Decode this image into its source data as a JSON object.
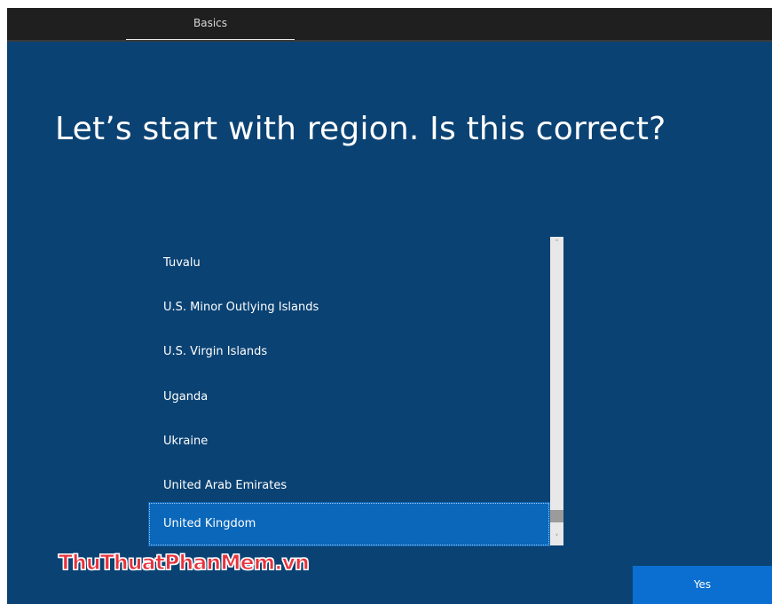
{
  "header": {
    "tab_label": "Basics"
  },
  "main": {
    "heading": "Let’s start with region. Is this correct?"
  },
  "region_list": {
    "items": [
      {
        "label": "Tuvalu"
      },
      {
        "label": "U.S. Minor Outlying Islands"
      },
      {
        "label": "U.S. Virgin Islands"
      },
      {
        "label": "Uganda"
      },
      {
        "label": "Ukraine"
      },
      {
        "label": "United Arab Emirates"
      },
      {
        "label": "United Kingdom"
      }
    ],
    "selected": "United Kingdom",
    "scroll_up_glyph": "˄",
    "scroll_down_glyph": "˅"
  },
  "footer": {
    "yes_label": "Yes"
  },
  "watermark": {
    "text": "ThuThuatPhanMem.vn"
  },
  "colors": {
    "background": "#0a4273",
    "topbar": "#1f1f1f",
    "selected_item": "#0a67ba",
    "yes_button": "#0a6fd1"
  }
}
